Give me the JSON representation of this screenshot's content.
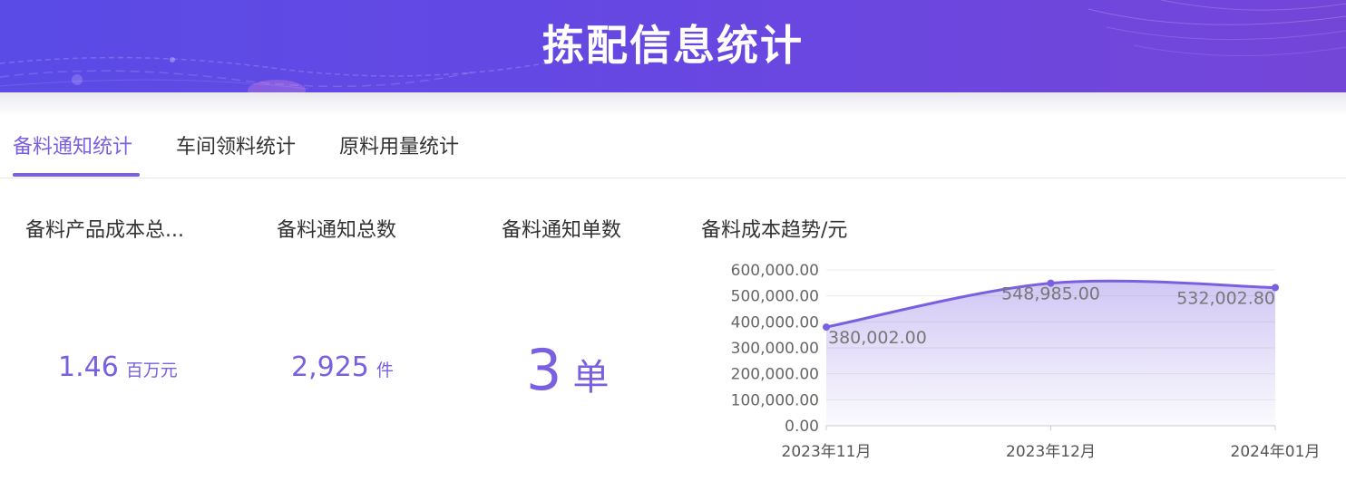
{
  "header": {
    "title": "拣配信息统计"
  },
  "tabs": [
    {
      "label": "备料通知统计",
      "active": true
    },
    {
      "label": "车间领料统计",
      "active": false
    },
    {
      "label": "原料用量统计",
      "active": false
    }
  ],
  "cards": {
    "cost_total": {
      "title": "备料产品成本总...",
      "value": "1.46",
      "unit": "百万元"
    },
    "notice_total": {
      "title": "备料通知总数",
      "value": "2,925",
      "unit": "件"
    },
    "notice_count": {
      "title": "备料通知单数",
      "value": "3",
      "unit": "单"
    },
    "trend": {
      "title": "备料成本趋势/元"
    }
  },
  "colors": {
    "accent": "#7a5fe0",
    "header_start": "#5a4be6",
    "header_end": "#7446d8"
  },
  "chart_data": {
    "type": "area",
    "title": "备料成本趋势/元",
    "categories": [
      "2023年11月",
      "2023年12月",
      "2024年01月"
    ],
    "values": [
      380002.0,
      548985.0,
      532002.8
    ],
    "data_labels": [
      "380,002.00",
      "548,985.00",
      "532,002.80"
    ],
    "y_ticks": [
      "0.00",
      "100,000.00",
      "200,000.00",
      "300,000.00",
      "400,000.00",
      "500,000.00",
      "600,000.00"
    ],
    "ylim": [
      0,
      600000
    ],
    "grid": true,
    "smooth": true,
    "color": "#7a5fe0"
  }
}
